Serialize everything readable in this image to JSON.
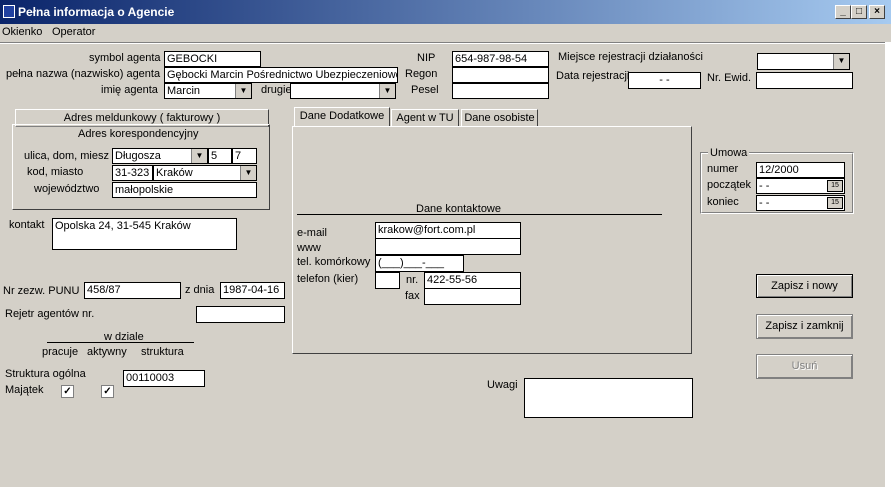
{
  "window": {
    "title": "Pełna informacja o Agencie",
    "minimize_glyph": "_",
    "maximize_glyph": "□",
    "close_glyph": "×"
  },
  "menu": [
    "Okienko",
    "Operator"
  ],
  "agent": {
    "symbol_label": "symbol agenta",
    "symbol_value": "GEBOCKI",
    "fullname_label": "pełna nazwa (nazwisko) agenta",
    "fullname_value": "Gębocki Marcin Pośrednictwo Ubezpieczeniowe",
    "firstname_label": "imię agenta",
    "firstname_value": "Marcin",
    "second_label": "drugie",
    "second_value": ""
  },
  "ids": {
    "nip_label": "NIP",
    "nip_value": "654-987-98-54",
    "regon_label": "Regon",
    "regon_value": "",
    "pesel_label": "Pesel",
    "pesel_value": ""
  },
  "registration": {
    "place_label": "Miejsce rejestracji  działaności",
    "place_value": "",
    "date_label": "Data rejestracji",
    "date_value": " -  -",
    "ewid_label": "Nr. Ewid.",
    "ewid_value": ""
  },
  "address": {
    "tab_meldunkowy": "Adres meldunkowy ( fakturowy )",
    "tab_korespondencyjny": "Adres korespondencyjny",
    "street_label": "ulica, dom, miesz",
    "street_value": "Długosza",
    "house_value": "5",
    "flat_value": "7",
    "city_label": "kod, miasto",
    "postcode_value": "31-323",
    "city_value": "Kraków",
    "voivodeship_label": "województwo",
    "voivodeship_value": "małopolskie"
  },
  "contact": {
    "label": "kontakt",
    "value": "Opolska 24, 31-545 Kraków"
  },
  "punu": {
    "label": "Nr zezw. PUNU",
    "value": "458/87",
    "date_label": "z dnia",
    "date_value": "1987-04-16",
    "register_label": "Rejetr agentów nr.",
    "register_value": ""
  },
  "department": {
    "heading": "w dziale",
    "col_pracuje": "pracuje",
    "col_aktywny": "aktywny",
    "col_struktura": "struktura",
    "structure_label": "Struktura ogólna",
    "structure_value": "00110003",
    "majatek_label": "Majątek",
    "check_pracuje": "✓",
    "check_aktywny": "✓"
  },
  "tabs": [
    "Dane Dodatkowe",
    "Agent w TU",
    "Dane osobiste"
  ],
  "contact_data": {
    "heading": "Dane kontaktowe",
    "email_label": "e-mail",
    "email_value": "krakow@fort.com.pl",
    "www_label": "www",
    "www_value": "",
    "mobile_label": "tel. komórkowy",
    "mobile_value": "(___)___-___",
    "phone_label": "telefon (kier)",
    "phone_prefix": "",
    "nr_label": "nr.",
    "phone_value": "422-55-56",
    "fax_label": "fax",
    "fax_value": ""
  },
  "notes": {
    "label": "Uwagi",
    "value": ""
  },
  "umowa": {
    "heading": "Umowa",
    "numer_label": "numer",
    "numer_value": "12/2000",
    "start_label": "początek",
    "start_value": "  -  -",
    "end_label": "koniec",
    "end_value": "  -  -",
    "cal_glyph": "15"
  },
  "buttons": {
    "save_new": "Zapisz i nowy",
    "save_close": "Zapisz i zamknij",
    "delete": "Usuń"
  }
}
